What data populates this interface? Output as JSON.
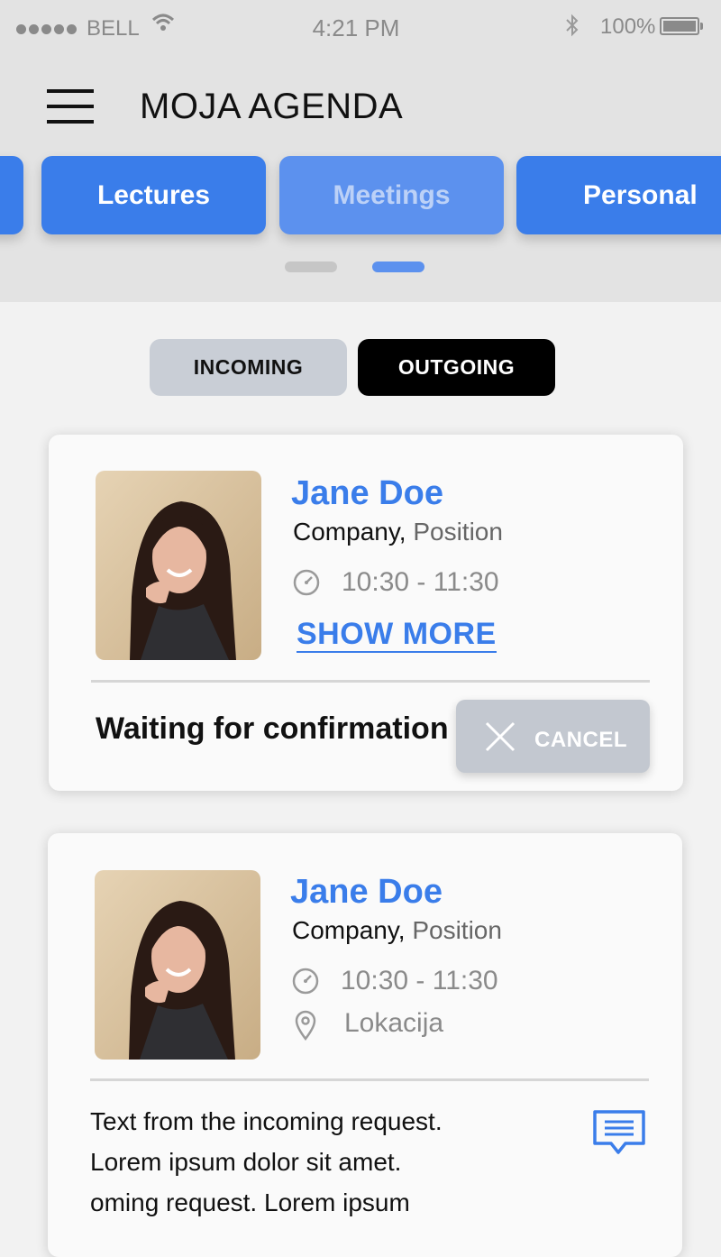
{
  "status_bar": {
    "carrier": "BELL",
    "time": "4:21 PM",
    "battery": "100%",
    "icons": [
      "signal-dots-icon",
      "wifi-icon",
      "bluetooth-icon",
      "battery-icon"
    ]
  },
  "header": {
    "title": "MOJA AGENDA",
    "menu_icon": "hamburger-menu-icon"
  },
  "categories": {
    "tabs": [
      {
        "label": "Lectures",
        "active": false
      },
      {
        "label": "Meetings",
        "active": true
      },
      {
        "label": "Personal",
        "active": false
      }
    ],
    "pager": {
      "count": 2,
      "active_index": 1
    }
  },
  "segment": {
    "incoming": "INCOMING",
    "outgoing": "OUTGOING",
    "selected": "OUTGOING"
  },
  "cards": [
    {
      "name": "Jane Doe",
      "company": "Company,",
      "position": "Position",
      "time": "10:30 - 11:30",
      "show_more": "SHOW MORE",
      "status": "Waiting for confirmation",
      "cancel": "CANCEL"
    },
    {
      "name": "Jane Doe",
      "company": "Company,",
      "position": "Position",
      "time": "10:30 - 11:30",
      "location": "Lokacija",
      "text_lines": [
        "Text from the incoming request.",
        "Lorem ipsum dolor sit amet.",
        "oming request. Lorem ipsum"
      ],
      "message_icon": "message-icon"
    }
  ],
  "colors": {
    "accent": "#3a7dea",
    "header_bg": "#e3e3e3",
    "page_bg": "#f2f2f2",
    "cancel_bg": "#c3c8d0"
  }
}
